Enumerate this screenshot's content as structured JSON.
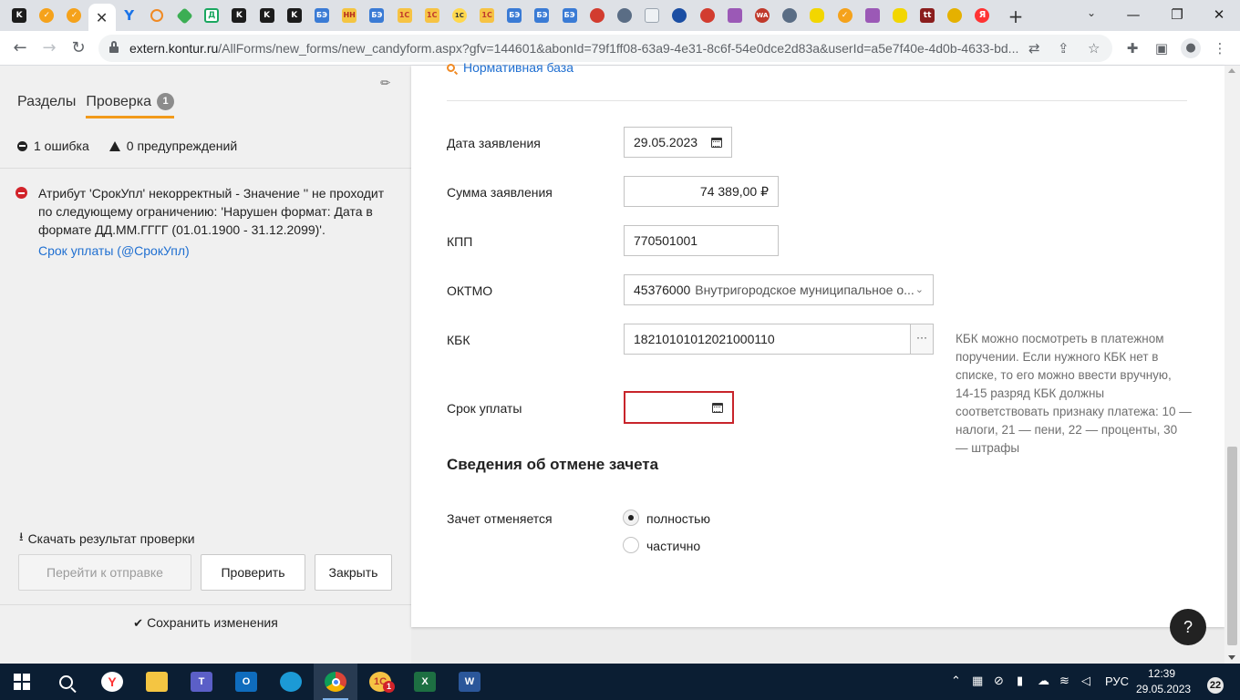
{
  "browser": {
    "tabs": [
      {
        "icon": "kontur-k-icon",
        "glyph": "K",
        "style": "k"
      },
      {
        "icon": "orange-check-icon",
        "glyph": "✓",
        "style": "orange"
      },
      {
        "icon": "orange-check-icon",
        "glyph": "✓",
        "style": "orange"
      },
      {
        "icon": "close-icon",
        "glyph": "✕",
        "style": "active"
      },
      {
        "icon": "y-icon",
        "glyph": "Y",
        "style": "bluey"
      },
      {
        "icon": "search-icon",
        "glyph": "",
        "style": "search"
      },
      {
        "icon": "green-diamond-icon",
        "glyph": "",
        "style": "green"
      },
      {
        "icon": "document-d-icon",
        "glyph": "Д",
        "style": "doc"
      },
      {
        "icon": "kontur-k-icon",
        "glyph": "K",
        "style": "k"
      },
      {
        "icon": "kontur-k-icon",
        "glyph": "K",
        "style": "k"
      },
      {
        "icon": "kontur-k-icon",
        "glyph": "K",
        "style": "k"
      },
      {
        "icon": "be-icon",
        "glyph": "БЭ",
        "style": "be"
      },
      {
        "icon": "nn-icon",
        "glyph": "НН",
        "style": "nn"
      },
      {
        "icon": "be-icon",
        "glyph": "БЭ",
        "style": "be"
      },
      {
        "icon": "1c-icon",
        "glyph": "1С",
        "style": "c1"
      },
      {
        "icon": "1c-icon",
        "glyph": "1С",
        "style": "c1"
      },
      {
        "icon": "yellow-circle-icon",
        "glyph": "1С",
        "style": "yellow"
      },
      {
        "icon": "1c-icon",
        "glyph": "1С",
        "style": "c1"
      },
      {
        "icon": "be-icon",
        "glyph": "БЭ",
        "style": "be"
      },
      {
        "icon": "be-icon",
        "glyph": "БЭ",
        "style": "be"
      },
      {
        "icon": "be-icon",
        "glyph": "БЭ",
        "style": "be"
      },
      {
        "icon": "red-leaf-icon",
        "glyph": "",
        "style": "red"
      },
      {
        "icon": "emblem-icon",
        "glyph": "",
        "style": "gray"
      },
      {
        "icon": "building-icon",
        "glyph": "",
        "style": "build"
      },
      {
        "icon": "blue-globe-icon",
        "glyph": "",
        "style": "navy"
      },
      {
        "icon": "red-leaf-icon",
        "glyph": "",
        "style": "red"
      },
      {
        "icon": "calculator-icon",
        "glyph": "",
        "style": "purple"
      },
      {
        "icon": "wa-icon",
        "glyph": "WA",
        "style": "wa"
      },
      {
        "icon": "emblem-icon",
        "glyph": "",
        "style": "gray"
      },
      {
        "icon": "lemon-icon",
        "glyph": "",
        "style": "lemon"
      },
      {
        "icon": "orange-check-icon",
        "glyph": "✓",
        "style": "orange"
      },
      {
        "icon": "calculator-icon",
        "glyph": "",
        "style": "purple"
      },
      {
        "icon": "yellow-feather-icon",
        "glyph": "",
        "style": "lemon"
      },
      {
        "icon": "tt-icon",
        "glyph": "tt",
        "style": "dark"
      },
      {
        "icon": "bee-icon",
        "glyph": "",
        "style": "bee"
      },
      {
        "icon": "yandex-icon",
        "glyph": "Я",
        "style": "ya"
      }
    ],
    "new_tab_glyph": "+",
    "url_host": "extern.kontur.ru",
    "url_path": "/AllForms/new_forms/new_candyform.aspx?gfv=144601&abonId=79f1ff08-63a9-4e31-8c6f-54e0dce2d83a&userId=a5e7f40e-4d0b-4633-bd..."
  },
  "panel": {
    "tabs": [
      "Разделы",
      "Проверка"
    ],
    "badge": "1",
    "errors_count": "1 ошибка",
    "warnings_count": "0 предупреждений",
    "error_text": "Атрибут 'СрокУпл' некорректный - Значение '' не проходит по следующему ограничению: 'Нарушен формат: Дата в формате ДД.ММ.ГГГГ (01.01.1900 - 31.12.2099)'.",
    "error_link": "Срок уплаты (@СрокУпл)",
    "download": "Скачать результат проверки",
    "btn_send": "Перейти к отправке",
    "btn_check": "Проверить",
    "btn_close": "Закрыть",
    "save": "Сохранить изменения"
  },
  "form": {
    "norm_link": "Нормативная база",
    "date_label": "Дата заявления",
    "date_value": "29.05.2023",
    "sum_label": "Сумма заявления",
    "sum_value": "74 389,00 ₽",
    "kpp_label": "КПП",
    "kpp_value": "770501001",
    "oktmo_label": "ОКТМО",
    "oktmo_code": "45376000",
    "oktmo_name": "Внутригородское муниципальное о...",
    "kbk_label": "КБК",
    "kbk_value": "18210101012021000110",
    "kbk_button": "···",
    "kbk_hint": "КБК можно посмотреть в платежном поручении. Если нужного КБК нет в списке, то его можно ввести вручную, 14-15 разряд КБК должны соответствовать признаку платежа: 10 — налоги, 21 — пени, 22 — проценты, 30 — штрафы",
    "due_label": "Срок уплаты",
    "due_value": "",
    "section_title": "Сведения об отмене зачета",
    "cancel_label": "Зачет отменяется",
    "radio_full": "полностью",
    "radio_partial": "частично",
    "selected_radio": "полностью",
    "help": "?"
  },
  "taskbar": {
    "language": "РУС",
    "time": "12:39",
    "date": "29.05.2023",
    "notifications": "22",
    "app_badge": "1"
  },
  "colors": {
    "accent": "#f29a1a",
    "link": "#1f6fd1",
    "error": "#d2232a",
    "panel_bg": "#f0f0f0",
    "taskbar_bg": "#0b1e33"
  }
}
